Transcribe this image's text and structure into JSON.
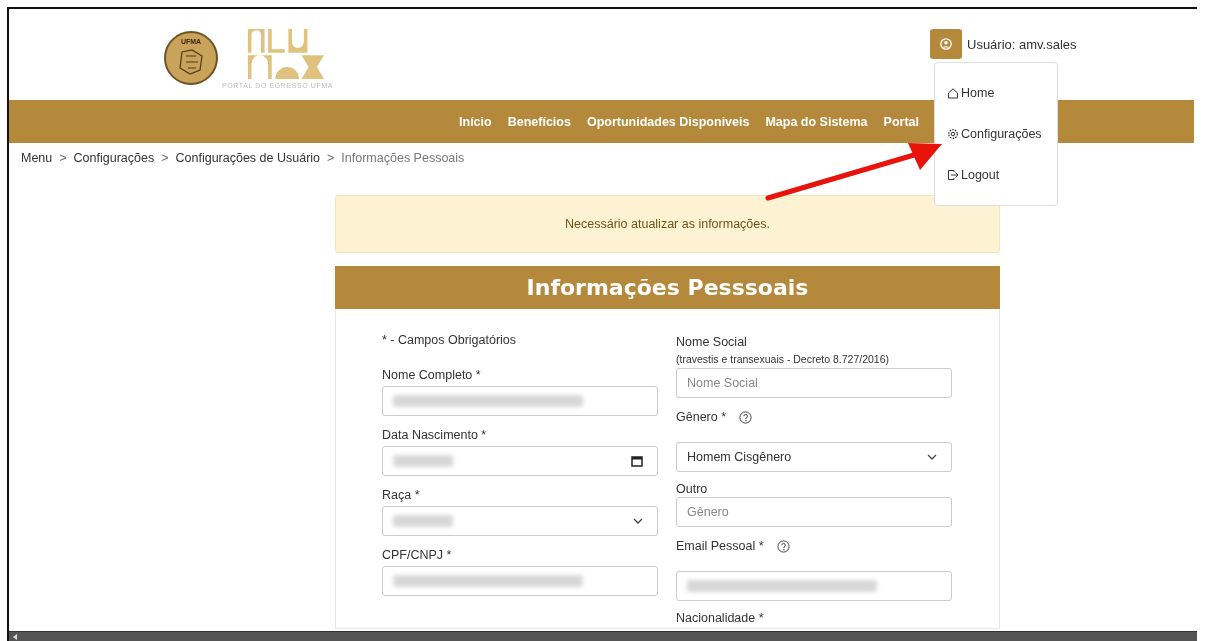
{
  "header": {
    "seal_text": "UFMA",
    "logo_tagline": "PORTAL DO EGRESSO UFMA",
    "user_label": "Usuário: amv.sales"
  },
  "user_menu": {
    "open": true,
    "items": [
      {
        "kind": "home",
        "label": "Home"
      },
      {
        "kind": "settings",
        "label": "Configurações"
      },
      {
        "kind": "logout",
        "label": "Logout"
      }
    ]
  },
  "nav": [
    "Início",
    "Benefícios",
    "Oportunidades Disponiveis",
    "Mapa do Sistema",
    "Portal"
  ],
  "breadcrumb": [
    {
      "label": "Menu",
      "current": false
    },
    {
      "label": "Configurações",
      "current": false
    },
    {
      "label": "Configurações de Usuário",
      "current": false
    },
    {
      "label": "Informações Pessoais",
      "current": true
    }
  ],
  "breadcrumb_separator": ">",
  "alert": "Necessário atualizar as informações.",
  "form_title": "Informações Pesssoais",
  "columns": [
    [
      {
        "kind": "note",
        "text": "* - Campos Obrigatórios"
      },
      {
        "kind": "label",
        "text": "Nome Completo *",
        "help": false
      },
      {
        "kind": "input",
        "redacted": true
      },
      {
        "kind": "label",
        "text": "Data Nascimento *",
        "help": false
      },
      {
        "kind": "date",
        "redacted": true
      },
      {
        "kind": "label",
        "text": "Raça *",
        "help": false
      },
      {
        "kind": "select",
        "redacted": true
      },
      {
        "kind": "label",
        "text": "CPF/CNPJ *",
        "help": false
      },
      {
        "kind": "input",
        "redacted": true
      }
    ],
    [
      {
        "kind": "label",
        "text": "Nome Social",
        "help": false,
        "hint": "(travestis e transexuais - Decreto 8.727/2016)"
      },
      {
        "kind": "input",
        "placeholder": "Nome Social",
        "redacted": false
      },
      {
        "kind": "label",
        "text": "Gênero *",
        "help": true
      },
      {
        "kind": "select",
        "value": "Homem Cisgênero",
        "redacted": false
      },
      {
        "kind": "label",
        "text": "Outro",
        "help": false
      },
      {
        "kind": "input",
        "placeholder": "Gênero",
        "redacted": false
      },
      {
        "kind": "label",
        "text": "Email Pessoal *",
        "help": true
      },
      {
        "kind": "input",
        "redacted": true
      },
      {
        "kind": "label",
        "text": "Nacionalidade *",
        "help": false
      }
    ]
  ]
}
